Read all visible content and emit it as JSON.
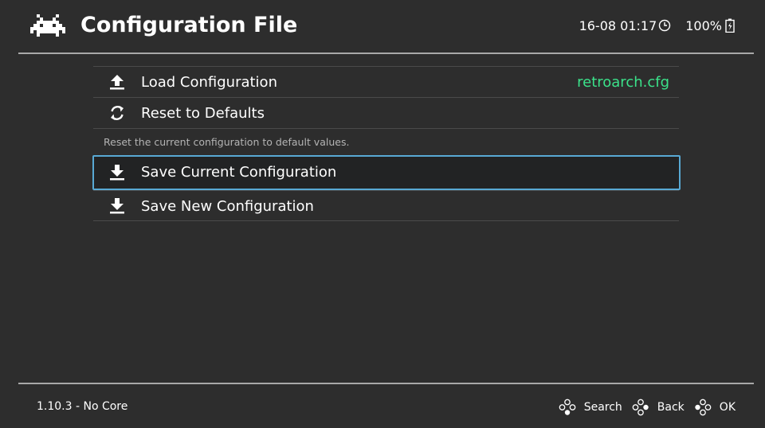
{
  "header": {
    "title": "Configuration File",
    "logo_icon": "retroarch-invader-icon",
    "datetime": "16-08 01:17",
    "clock_icon": "clock-icon",
    "battery": "100%",
    "battery_icon": "battery-icon"
  },
  "menu": {
    "items": [
      {
        "label": "Load Configuration",
        "value": "retroarch.cfg",
        "icon": "upload-icon"
      },
      {
        "label": "Reset to Defaults",
        "icon": "refresh-icon",
        "sublabel": "Reset the current configuration to default values."
      },
      {
        "label": "Save Current Configuration",
        "icon": "download-icon"
      },
      {
        "label": "Save New Configuration",
        "icon": "download-icon"
      }
    ],
    "selected_index": 2
  },
  "footer": {
    "version": "1.10.3 - No Core",
    "actions": [
      {
        "label": "Search",
        "icon": "gamepad-buttons-icon"
      },
      {
        "label": "Back",
        "icon": "gamepad-buttons-icon"
      },
      {
        "label": "OK",
        "icon": "gamepad-buttons-icon"
      }
    ]
  },
  "colors": {
    "background": "#2d2d2d",
    "accent_value": "#3be28a",
    "selection_border": "#58a9d4",
    "divider": "#a8a8a8"
  }
}
